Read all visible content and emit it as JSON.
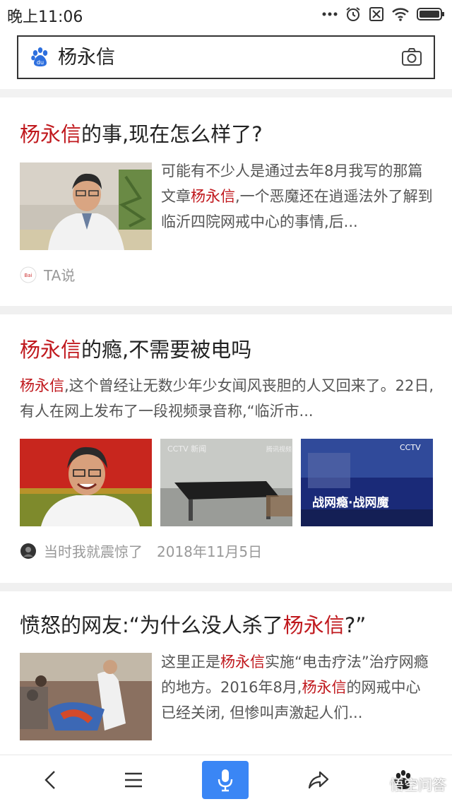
{
  "status_bar": {
    "time": "晚上11:06"
  },
  "search": {
    "query": "杨永信",
    "logo_icon": "baidu-paw-icon",
    "camera_icon": "camera-icon"
  },
  "results": [
    {
      "title_highlight": "杨永信",
      "title_rest": "的事,现在怎么样了?",
      "snippet_1": "可能有不少人是通过去年8月我写的那篇文章",
      "snippet_highlight": "杨永信",
      "snippet_2": ",一个恶魔还在逍遥法外了解到临沂四院网戒中心的事情,后...",
      "source": "TA说"
    },
    {
      "title_highlight": "杨永信",
      "title_rest": "的瘾,不需要被电吗",
      "snippet_highlight": "杨永信",
      "snippet_rest": ",这个曾经让无数少年少女闻风丧胆的人又回来了。22日,有人在网上发布了一段视频录音称,“临沂市...",
      "source": "当时我就震惊了",
      "date": "2018年11月5日",
      "image_labels": [
        "CCTV 新闻",
        "腾讯视频",
        "CCTV",
        "战网瘾·战网魔"
      ]
    },
    {
      "title_prefix": "愤怒的网友:“为什么没人杀了",
      "title_highlight": "杨永信",
      "title_suffix": "?”",
      "snippet_1": "这里正是",
      "snippet_highlight_1": "杨永信",
      "snippet_2": "实施“电击疗法”治疗网瘾的地方。2016年8月,",
      "snippet_highlight_2": "杨永信",
      "snippet_3": "的网戒中心已经关闭, 但惨叫声激起人们..."
    }
  ],
  "bottom_nav": {
    "watermark": "悟空问答"
  },
  "colors": {
    "highlight": "#c0181d",
    "mic_button": "#3a86f5"
  }
}
